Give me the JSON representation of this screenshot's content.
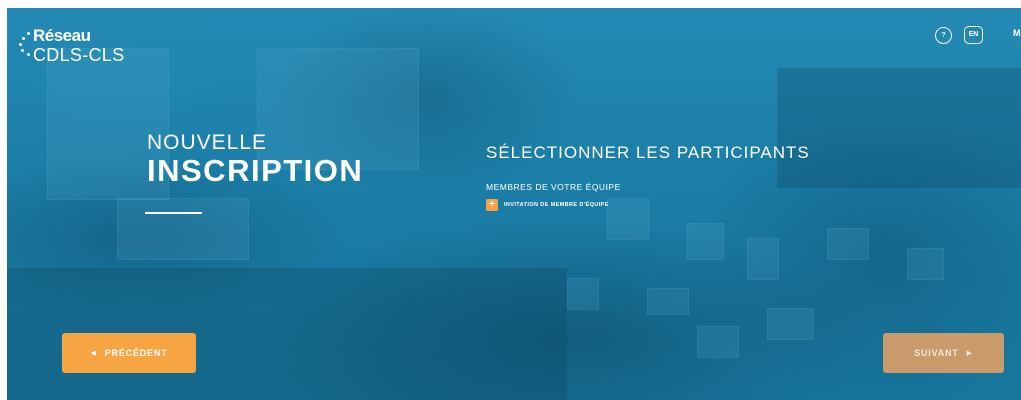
{
  "logo": {
    "line1": "Réseau",
    "line2": "CDLS-CLS"
  },
  "header": {
    "help_icon_label": "?",
    "language_label": "EN",
    "menu_label": "M",
    "icons": [
      "help-icon",
      "language-toggle",
      "menu"
    ]
  },
  "title": {
    "line1": "NOUVELLE",
    "line2": "INSCRIPTION"
  },
  "participants": {
    "heading": "SÉLECTIONNER LES PARTICIPANTS",
    "team_label": "MEMBRES DE VOTRE ÉQUIPE",
    "invite_icon": "+",
    "invite_label": "INVITATION DE MEMBRE D'ÉQUIPE"
  },
  "navigation": {
    "previous_icon": "◀",
    "previous_label": "PRÉCÉDENT",
    "next_label": "SUIVANT",
    "next_icon": "▶"
  },
  "colors": {
    "background_blue": "#1d7ea8",
    "accent_orange": "#f7a442",
    "disabled_orange": "#c99a6a"
  }
}
